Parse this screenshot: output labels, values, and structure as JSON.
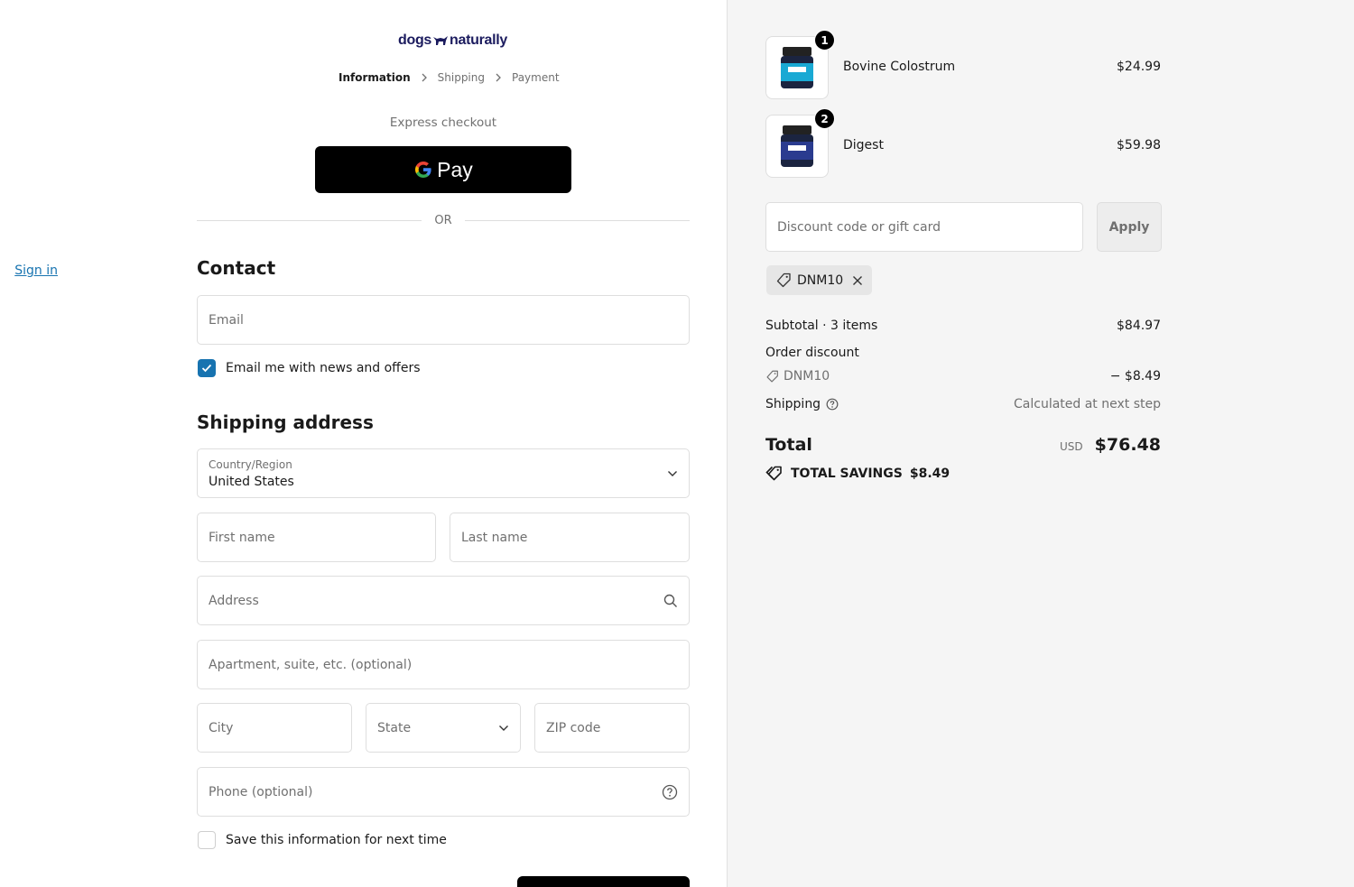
{
  "brand": {
    "logo_left": "dogs",
    "logo_right": "naturally"
  },
  "breadcrumb": [
    {
      "label": "Information",
      "active": true
    },
    {
      "label": "Shipping",
      "active": false
    },
    {
      "label": "Payment",
      "active": false
    }
  ],
  "express": {
    "title": "Express checkout",
    "gpay_label": "Pay",
    "or_label": "OR"
  },
  "contact": {
    "heading": "Contact",
    "signin_label": "Sign in",
    "email_placeholder": "Email",
    "newsletter_label": "Email me with news and offers",
    "newsletter_checked": true
  },
  "shipping": {
    "heading": "Shipping address",
    "country_label": "Country/Region",
    "country_value": "United States",
    "first_name_placeholder": "First name",
    "last_name_placeholder": "Last name",
    "address_placeholder": "Address",
    "apartment_placeholder": "Apartment, suite, etc. (optional)",
    "city_placeholder": "City",
    "state_placeholder": "State",
    "zip_placeholder": "ZIP code",
    "phone_placeholder": "Phone (optional)",
    "save_label": "Save this information for next time",
    "save_checked": false
  },
  "cart": {
    "items": [
      {
        "name": "Bovine Colostrum",
        "price": "$24.99",
        "qty": "1",
        "color": "#19a9d4"
      },
      {
        "name": "Digest",
        "price": "$59.98",
        "qty": "2",
        "color": "#2a3b8f"
      }
    ],
    "discount_placeholder": "Discount code or gift card",
    "apply_label": "Apply",
    "applied_code": "DNM10",
    "subtotal_label": "Subtotal · 3 items",
    "subtotal_value": "$84.97",
    "order_discount_label": "Order discount",
    "discount_code": "DNM10",
    "discount_value": "− $8.49",
    "shipping_label": "Shipping",
    "shipping_value": "Calculated at next step",
    "total_label": "Total",
    "total_currency": "USD",
    "total_value": "$76.48",
    "savings_label": "TOTAL SAVINGS",
    "savings_value": "$8.49"
  },
  "colors": {
    "accent": "#1773b0",
    "panel": "#f5f5f5",
    "button": "#000000"
  }
}
